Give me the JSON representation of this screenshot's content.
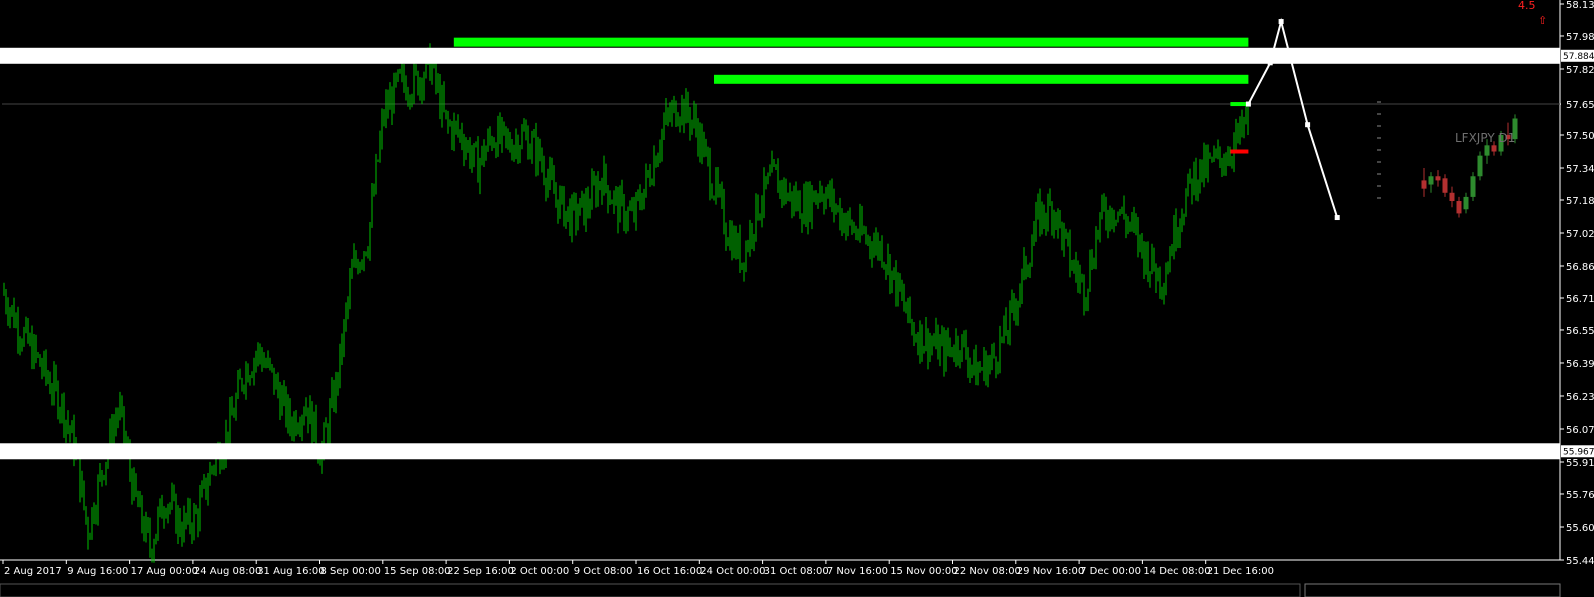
{
  "chart_data": {
    "type": "candlestick",
    "symbol_label": "LFXJPY D1",
    "corner_value": "4.5",
    "corner_arrow": "⇧",
    "ylim": [
      55.44,
      58.135
    ],
    "y_ticks": [
      "58.135",
      "57.980",
      "57.820",
      "57.650",
      "57.500",
      "57.340",
      "57.185",
      "57.025",
      "56.865",
      "56.710",
      "56.555",
      "56.395",
      "56.235",
      "56.075",
      "55.915",
      "55.760",
      "55.600",
      "55.440"
    ],
    "y_tick_values": [
      58.135,
      57.98,
      57.82,
      57.65,
      57.5,
      57.34,
      57.185,
      57.025,
      56.865,
      56.71,
      56.555,
      56.395,
      56.235,
      56.075,
      55.915,
      55.76,
      55.6,
      55.44
    ],
    "x_ticks": [
      "2 Aug 2017",
      "9 Aug 16:00",
      "17 Aug 00:00",
      "24 Aug 08:00",
      "31 Aug 16:00",
      "8 Sep 00:00",
      "15 Sep 08:00",
      "22 Sep 16:00",
      "2 Oct 00:00",
      "9 Oct 08:00",
      "16 Oct 16:00",
      "24 Oct 00:00",
      "31 Oct 08:00",
      "7 Nov 16:00",
      "15 Nov 00:00",
      "22 Nov 08:00",
      "29 Nov 16:00",
      "7 Dec 00:00",
      "14 Dec 08:00",
      "21 Dec 16:00"
    ],
    "price_tags": [
      {
        "label": "57.884",
        "value": 57.884
      },
      {
        "label": "55.967",
        "value": 55.967
      }
    ],
    "current_price": {
      "label": "57.650",
      "value": 57.65
    },
    "resistance_levels": [
      {
        "name": "upper-resistance",
        "value": 57.95,
        "from": 0.29,
        "to": 0.8
      },
      {
        "name": "lower-resistance",
        "value": 57.77,
        "from": 0.457,
        "to": 0.8
      }
    ],
    "support_zones": [
      {
        "value": 57.884
      },
      {
        "value": 55.967
      }
    ],
    "bar_series": [
      [
        0.0,
        56.75
      ],
      [
        0.012,
        56.55
      ],
      [
        0.025,
        56.38
      ],
      [
        0.038,
        56.2
      ],
      [
        0.047,
        55.98
      ],
      [
        0.055,
        55.58
      ],
      [
        0.065,
        55.9
      ],
      [
        0.075,
        56.18
      ],
      [
        0.085,
        55.75
      ],
      [
        0.095,
        55.5
      ],
      [
        0.105,
        55.75
      ],
      [
        0.115,
        55.6
      ],
      [
        0.125,
        55.65
      ],
      [
        0.135,
        55.9
      ],
      [
        0.145,
        56.05
      ],
      [
        0.155,
        56.35
      ],
      [
        0.165,
        56.45
      ],
      [
        0.175,
        56.3
      ],
      [
        0.185,
        56.1
      ],
      [
        0.195,
        56.2
      ],
      [
        0.205,
        55.95
      ],
      [
        0.215,
        56.3
      ],
      [
        0.225,
        56.85
      ],
      [
        0.235,
        57.0
      ],
      [
        0.245,
        57.6
      ],
      [
        0.255,
        57.75
      ],
      [
        0.265,
        57.75
      ],
      [
        0.275,
        57.85
      ],
      [
        0.285,
        57.55
      ],
      [
        0.295,
        57.5
      ],
      [
        0.305,
        57.35
      ],
      [
        0.315,
        57.5
      ],
      [
        0.325,
        57.45
      ],
      [
        0.335,
        57.5
      ],
      [
        0.345,
        57.4
      ],
      [
        0.355,
        57.2
      ],
      [
        0.365,
        57.1
      ],
      [
        0.375,
        57.15
      ],
      [
        0.385,
        57.3
      ],
      [
        0.395,
        57.15
      ],
      [
        0.405,
        57.1
      ],
      [
        0.415,
        57.3
      ],
      [
        0.425,
        57.55
      ],
      [
        0.435,
        57.65
      ],
      [
        0.445,
        57.55
      ],
      [
        0.455,
        57.3
      ],
      [
        0.465,
        57.05
      ],
      [
        0.475,
        56.9
      ],
      [
        0.485,
        57.15
      ],
      [
        0.495,
        57.3
      ],
      [
        0.505,
        57.2
      ],
      [
        0.515,
        57.15
      ],
      [
        0.525,
        57.25
      ],
      [
        0.535,
        57.15
      ],
      [
        0.545,
        57.05
      ],
      [
        0.555,
        57.0
      ],
      [
        0.565,
        56.95
      ],
      [
        0.575,
        56.75
      ],
      [
        0.585,
        56.55
      ],
      [
        0.595,
        56.5
      ],
      [
        0.605,
        56.45
      ],
      [
        0.615,
        56.5
      ],
      [
        0.625,
        56.35
      ],
      [
        0.635,
        56.4
      ],
      [
        0.645,
        56.55
      ],
      [
        0.655,
        56.8
      ],
      [
        0.665,
        57.1
      ],
      [
        0.675,
        57.15
      ],
      [
        0.685,
        56.9
      ],
      [
        0.695,
        56.75
      ],
      [
        0.705,
        57.1
      ],
      [
        0.715,
        57.15
      ],
      [
        0.725,
        57.05
      ],
      [
        0.735,
        56.9
      ],
      [
        0.745,
        56.8
      ],
      [
        0.755,
        57.1
      ],
      [
        0.765,
        57.3
      ],
      [
        0.775,
        57.35
      ],
      [
        0.785,
        57.4
      ],
      [
        0.795,
        57.5
      ],
      [
        0.8,
        57.58
      ]
    ],
    "projection": [
      [
        0.8,
        57.65
      ],
      [
        0.814,
        57.85
      ],
      [
        0.821,
        58.05
      ],
      [
        0.838,
        57.55
      ],
      [
        0.857,
        57.1
      ]
    ],
    "small_candles": [
      {
        "o": 57.28,
        "h": 57.34,
        "l": 57.2,
        "c": 57.24
      },
      {
        "o": 57.26,
        "h": 57.32,
        "l": 57.22,
        "c": 57.3
      },
      {
        "o": 57.3,
        "h": 57.33,
        "l": 57.25,
        "c": 57.28
      },
      {
        "o": 57.29,
        "h": 57.31,
        "l": 57.2,
        "c": 57.22
      },
      {
        "o": 57.22,
        "h": 57.25,
        "l": 57.15,
        "c": 57.18
      },
      {
        "o": 57.18,
        "h": 57.2,
        "l": 57.1,
        "c": 57.12
      },
      {
        "o": 57.14,
        "h": 57.22,
        "l": 57.12,
        "c": 57.2
      },
      {
        "o": 57.2,
        "h": 57.32,
        "l": 57.18,
        "c": 57.3
      },
      {
        "o": 57.3,
        "h": 57.42,
        "l": 57.28,
        "c": 57.4
      },
      {
        "o": 57.4,
        "h": 57.48,
        "l": 57.36,
        "c": 57.45
      },
      {
        "o": 57.45,
        "h": 57.47,
        "l": 57.4,
        "c": 57.42
      },
      {
        "o": 57.42,
        "h": 57.52,
        "l": 57.4,
        "c": 57.5
      },
      {
        "o": 57.5,
        "h": 57.56,
        "l": 57.45,
        "c": 57.48
      },
      {
        "o": 57.48,
        "h": 57.6,
        "l": 57.46,
        "c": 57.58
      }
    ],
    "colors": {
      "background": "#000000",
      "bars": "#00c000",
      "resistance": "#00ff00",
      "support_zone": "#ffffff",
      "projection": "#ffffff",
      "bull_candle": "#2e8b2e",
      "bear_candle": "#b23030",
      "stop_marker": "#ff0000",
      "current_price_line": "#444444"
    }
  }
}
